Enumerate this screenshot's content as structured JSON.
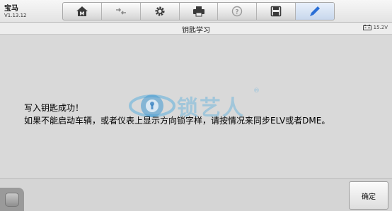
{
  "header": {
    "app_title": "宝马",
    "version": "V1.13.12"
  },
  "toolbar": {
    "buttons": [
      {
        "icon": "home-icon"
      },
      {
        "icon": "vehicle-swap-icon"
      },
      {
        "icon": "gear-icon"
      },
      {
        "icon": "print-icon"
      },
      {
        "icon": "help-icon"
      },
      {
        "icon": "save-icon"
      },
      {
        "icon": "pencil-icon",
        "active": true
      }
    ]
  },
  "subheader": {
    "title": "钥匙学习",
    "battery_voltage": "15.2V"
  },
  "message": {
    "line1": "写入钥匙成功！",
    "line2": "如果不能启动车辆，或者仪表上显示方向锁字样，请按情况来同步ELV或者DME。"
  },
  "watermark": {
    "text": "锁艺人",
    "registered": "®"
  },
  "footer": {
    "ok_label": "确定"
  },
  "colors": {
    "background": "#d9d9d9",
    "toolbar_icon": "#3a3a3a",
    "active_pencil": "#2a6fd6",
    "watermark": "#50aadc"
  }
}
